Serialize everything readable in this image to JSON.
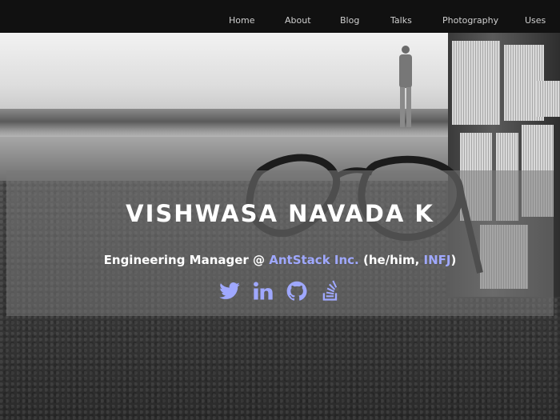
{
  "nav": {
    "items": [
      {
        "label": "Home"
      },
      {
        "label": "About"
      },
      {
        "label": "Blog"
      },
      {
        "label": "Talks"
      },
      {
        "label": "Photography"
      },
      {
        "label": "Uses"
      }
    ]
  },
  "hero": {
    "name": "VISHWASA NAVADA K",
    "subtitle_prefix": "Engineering Manager @ ",
    "company": "AntStack Inc.",
    "subtitle_mid": " (he/him, ",
    "personality": "INFJ",
    "subtitle_suffix": ")"
  },
  "social": {
    "icons": [
      "twitter-icon",
      "linkedin-icon",
      "github-icon",
      "stackoverflow-icon"
    ]
  },
  "colors": {
    "nav_bg": "#111111",
    "accent": "#9fa8ff",
    "text": "#ffffff"
  }
}
